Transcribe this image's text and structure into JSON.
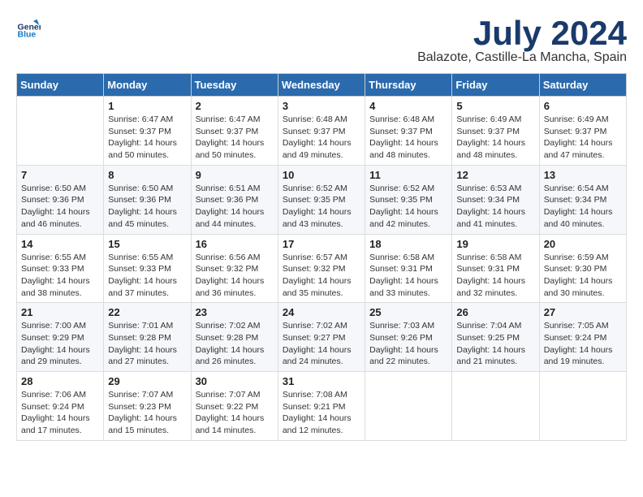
{
  "header": {
    "logo_line1": "General",
    "logo_line2": "Blue",
    "month": "July 2024",
    "location": "Balazote, Castille-La Mancha, Spain"
  },
  "weekdays": [
    "Sunday",
    "Monday",
    "Tuesday",
    "Wednesday",
    "Thursday",
    "Friday",
    "Saturday"
  ],
  "weeks": [
    [
      {
        "day": "",
        "info": ""
      },
      {
        "day": "1",
        "info": "Sunrise: 6:47 AM\nSunset: 9:37 PM\nDaylight: 14 hours\nand 50 minutes."
      },
      {
        "day": "2",
        "info": "Sunrise: 6:47 AM\nSunset: 9:37 PM\nDaylight: 14 hours\nand 50 minutes."
      },
      {
        "day": "3",
        "info": "Sunrise: 6:48 AM\nSunset: 9:37 PM\nDaylight: 14 hours\nand 49 minutes."
      },
      {
        "day": "4",
        "info": "Sunrise: 6:48 AM\nSunset: 9:37 PM\nDaylight: 14 hours\nand 48 minutes."
      },
      {
        "day": "5",
        "info": "Sunrise: 6:49 AM\nSunset: 9:37 PM\nDaylight: 14 hours\nand 48 minutes."
      },
      {
        "day": "6",
        "info": "Sunrise: 6:49 AM\nSunset: 9:37 PM\nDaylight: 14 hours\nand 47 minutes."
      }
    ],
    [
      {
        "day": "7",
        "info": "Sunrise: 6:50 AM\nSunset: 9:36 PM\nDaylight: 14 hours\nand 46 minutes."
      },
      {
        "day": "8",
        "info": "Sunrise: 6:50 AM\nSunset: 9:36 PM\nDaylight: 14 hours\nand 45 minutes."
      },
      {
        "day": "9",
        "info": "Sunrise: 6:51 AM\nSunset: 9:36 PM\nDaylight: 14 hours\nand 44 minutes."
      },
      {
        "day": "10",
        "info": "Sunrise: 6:52 AM\nSunset: 9:35 PM\nDaylight: 14 hours\nand 43 minutes."
      },
      {
        "day": "11",
        "info": "Sunrise: 6:52 AM\nSunset: 9:35 PM\nDaylight: 14 hours\nand 42 minutes."
      },
      {
        "day": "12",
        "info": "Sunrise: 6:53 AM\nSunset: 9:34 PM\nDaylight: 14 hours\nand 41 minutes."
      },
      {
        "day": "13",
        "info": "Sunrise: 6:54 AM\nSunset: 9:34 PM\nDaylight: 14 hours\nand 40 minutes."
      }
    ],
    [
      {
        "day": "14",
        "info": "Sunrise: 6:55 AM\nSunset: 9:33 PM\nDaylight: 14 hours\nand 38 minutes."
      },
      {
        "day": "15",
        "info": "Sunrise: 6:55 AM\nSunset: 9:33 PM\nDaylight: 14 hours\nand 37 minutes."
      },
      {
        "day": "16",
        "info": "Sunrise: 6:56 AM\nSunset: 9:32 PM\nDaylight: 14 hours\nand 36 minutes."
      },
      {
        "day": "17",
        "info": "Sunrise: 6:57 AM\nSunset: 9:32 PM\nDaylight: 14 hours\nand 35 minutes."
      },
      {
        "day": "18",
        "info": "Sunrise: 6:58 AM\nSunset: 9:31 PM\nDaylight: 14 hours\nand 33 minutes."
      },
      {
        "day": "19",
        "info": "Sunrise: 6:58 AM\nSunset: 9:31 PM\nDaylight: 14 hours\nand 32 minutes."
      },
      {
        "day": "20",
        "info": "Sunrise: 6:59 AM\nSunset: 9:30 PM\nDaylight: 14 hours\nand 30 minutes."
      }
    ],
    [
      {
        "day": "21",
        "info": "Sunrise: 7:00 AM\nSunset: 9:29 PM\nDaylight: 14 hours\nand 29 minutes."
      },
      {
        "day": "22",
        "info": "Sunrise: 7:01 AM\nSunset: 9:28 PM\nDaylight: 14 hours\nand 27 minutes."
      },
      {
        "day": "23",
        "info": "Sunrise: 7:02 AM\nSunset: 9:28 PM\nDaylight: 14 hours\nand 26 minutes."
      },
      {
        "day": "24",
        "info": "Sunrise: 7:02 AM\nSunset: 9:27 PM\nDaylight: 14 hours\nand 24 minutes."
      },
      {
        "day": "25",
        "info": "Sunrise: 7:03 AM\nSunset: 9:26 PM\nDaylight: 14 hours\nand 22 minutes."
      },
      {
        "day": "26",
        "info": "Sunrise: 7:04 AM\nSunset: 9:25 PM\nDaylight: 14 hours\nand 21 minutes."
      },
      {
        "day": "27",
        "info": "Sunrise: 7:05 AM\nSunset: 9:24 PM\nDaylight: 14 hours\nand 19 minutes."
      }
    ],
    [
      {
        "day": "28",
        "info": "Sunrise: 7:06 AM\nSunset: 9:24 PM\nDaylight: 14 hours\nand 17 minutes."
      },
      {
        "day": "29",
        "info": "Sunrise: 7:07 AM\nSunset: 9:23 PM\nDaylight: 14 hours\nand 15 minutes."
      },
      {
        "day": "30",
        "info": "Sunrise: 7:07 AM\nSunset: 9:22 PM\nDaylight: 14 hours\nand 14 minutes."
      },
      {
        "day": "31",
        "info": "Sunrise: 7:08 AM\nSunset: 9:21 PM\nDaylight: 14 hours\nand 12 minutes."
      },
      {
        "day": "",
        "info": ""
      },
      {
        "day": "",
        "info": ""
      },
      {
        "day": "",
        "info": ""
      }
    ]
  ]
}
